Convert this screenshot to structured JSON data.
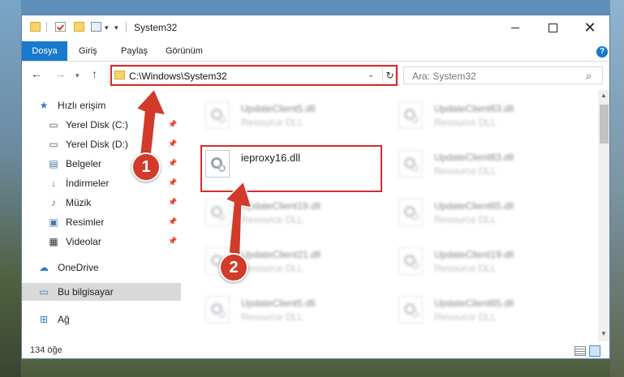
{
  "window": {
    "title": "System32"
  },
  "ribbon": {
    "tabs": [
      "Dosya",
      "Giriş",
      "Paylaş",
      "Görünüm"
    ]
  },
  "address": {
    "path": "C:\\Windows\\System32"
  },
  "search": {
    "placeholder": "Ara: System32"
  },
  "sidebar": {
    "items": [
      {
        "label": "Hızlı erişim",
        "icon": "star-icon"
      },
      {
        "label": "Yerel Disk (C:)",
        "icon": "drive-icon"
      },
      {
        "label": "Yerel Disk (D:)",
        "icon": "drive-icon"
      },
      {
        "label": "Belgeler",
        "icon": "documents-icon"
      },
      {
        "label": "İndirmeler",
        "icon": "download-icon"
      },
      {
        "label": "Müzik",
        "icon": "music-icon"
      },
      {
        "label": "Resimler",
        "icon": "pictures-icon"
      },
      {
        "label": "Videolar",
        "icon": "video-icon"
      },
      {
        "label": "OneDrive",
        "icon": "cloud-icon"
      },
      {
        "label": "Bu bilgisayar",
        "icon": "computer-icon"
      },
      {
        "label": "Ağ",
        "icon": "network-icon"
      }
    ]
  },
  "files": [
    {
      "name": "UpdateClient5.dll",
      "type": "Resource DLL"
    },
    {
      "name": "UpdateClient63.dll",
      "type": "Resource DLL"
    },
    {
      "name": "ieproxy16.dll",
      "type": ""
    },
    {
      "name": "UpdateClient63.dll",
      "type": "Resource DLL"
    },
    {
      "name": "UpdateClient19.dll",
      "type": "Resource DLL"
    },
    {
      "name": "UpdateClient65.dll",
      "type": "Resource DLL"
    },
    {
      "name": "UpdateClient21.dll",
      "type": "Resource DLL"
    },
    {
      "name": "UpdateClient19.dll",
      "type": "Resource DLL"
    },
    {
      "name": "UpdateClient5.dll",
      "type": "Resource DLL"
    },
    {
      "name": "UpdateClient65.dll",
      "type": "Resource DLL"
    }
  ],
  "status": {
    "count": "134 öğe"
  },
  "annotations": {
    "step1": "1",
    "step2": "2",
    "color": "#d23a2a"
  }
}
